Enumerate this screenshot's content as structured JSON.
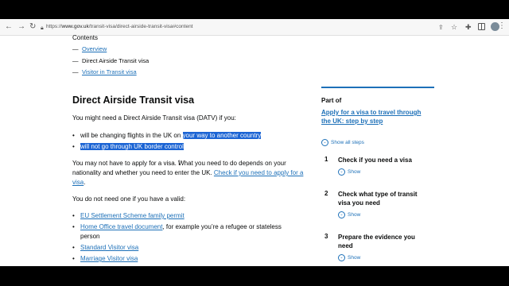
{
  "browser": {
    "url_prefix": "https://",
    "url_host": "www.gov.uk",
    "url_path": "/transit-visa/direct-airside-transit-visa#content",
    "back_icon": "arrow-left-icon",
    "forward_icon": "arrow-right-icon",
    "reload_icon": "reload-icon"
  },
  "contents": {
    "heading": "Contents",
    "items": [
      {
        "label": "Overview",
        "link": true
      },
      {
        "label": "Direct Airside Transit visa",
        "link": false
      },
      {
        "label": "Visitor in Transit visa",
        "link": true
      }
    ]
  },
  "main": {
    "title": "Direct Airside Transit visa",
    "intro": "You might need a Direct Airside Transit visa (DATV) if you:",
    "bullets1": [
      {
        "plain": "will be changing flights in the UK on ",
        "highlighted": "your way to another country"
      },
      {
        "plain": "",
        "highlighted": "will not go through UK border control"
      }
    ],
    "para2_text": "You may not have to apply for a visa. What you need to do depends on your nationality and whether you need to enter the UK.",
    "para2_link": "Check if you need to apply for a visa",
    "para2_end": ".",
    "para3": "You do not need one if you have a valid:",
    "bullets2": [
      {
        "link": "EU Settlement Scheme family permit",
        "rest": ""
      },
      {
        "link": "Home Office travel document",
        "rest": ", for example you’re a refugee or stateless",
        "rest2": "person"
      },
      {
        "link": "Standard Visitor visa",
        "rest": ""
      },
      {
        "link": "Marriage Visitor visa",
        "rest": ""
      }
    ]
  },
  "side": {
    "part_of": "Part of",
    "link_line1": "Apply for a visa to travel through",
    "link_line2": "the UK: step by step",
    "show_all": "Show all steps",
    "steps": [
      {
        "num": "1",
        "title_line1": "Check if you need a visa",
        "title_line2": "",
        "show": "Show"
      },
      {
        "num": "2",
        "title_line1": "Check what type of transit",
        "title_line2": "visa you need",
        "show": "Show"
      },
      {
        "num": "3",
        "title_line1": "Prepare the evidence you",
        "title_line2": "need",
        "show": "Show"
      }
    ]
  },
  "colors": {
    "link": "#1d70b8",
    "highlight": "#1b64d4",
    "text": "#0b0c0c"
  }
}
